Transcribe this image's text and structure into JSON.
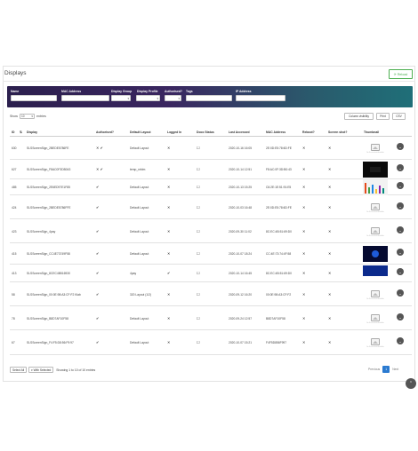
{
  "page": {
    "title": "Displays",
    "reload_label": "Reload"
  },
  "filters": {
    "name_label": "Name",
    "mac_label": "MAC Address",
    "display_group_label": "Display Group",
    "display_profile_label": "Display Profile",
    "authorised_label": "Authorised?",
    "tags_label": "Tags",
    "ip_label": "IP Address"
  },
  "table_controls": {
    "show_label": "Show",
    "page_length": "10",
    "entries_label": "entries",
    "column_visibility_label": "Column visibility",
    "print_label": "Print",
    "csv_label": "CSV"
  },
  "columns": {
    "id": "ID",
    "display": "Display",
    "authorised": "Authorised?",
    "default_layout": "Default Layout",
    "logged_in": "Logged In",
    "dooc_status": "Dooc Status",
    "last_accessed": "Last Accessed",
    "mac": "MAC Address",
    "reboot": "Reboot?",
    "screen_shot": "Screen shot?",
    "thumbnail": "Thumbnail"
  },
  "rows": [
    {
      "id": "630",
      "display": "SLSScreenSign_2BEDE5786FE",
      "authorised": "✕ ✔",
      "layout": "Default Layout",
      "logged": "✕",
      "dooc": "☐",
      "last": "2020-10-16 16:05",
      "mac": "2E:0D:E5:78:6D:FE",
      "reboot": "✕",
      "shot": "✕",
      "thumb": "placeholder"
    },
    {
      "id": "627",
      "display": "SLSScreenSign_F8AC0F3DB043",
      "authorised": "✕ ✔",
      "layout": "temp_nrbim",
      "logged": "✕",
      "dooc": "☐",
      "last": "2020-10-14 12:51",
      "mac": "F8:AC:0F:3D:B0:43",
      "reboot": "✕",
      "shot": "✕",
      "thumb": "dark"
    },
    {
      "id": "485",
      "display": "SLSScreenSign_2E6ED97E1F85",
      "authorised": "✔",
      "layout": "Default Layout",
      "logged": "✕",
      "dooc": "☐",
      "last": "2020-10-13 15:25",
      "mac": "C6:2E:1E:51:91:E5",
      "reboot": "✕",
      "shot": "✕",
      "thumb": "chart"
    },
    {
      "id": "424",
      "display": "SLSScreenSign_2BEDE5786FFE",
      "authorised": "✔",
      "layout": "Default Layout",
      "logged": "✕",
      "dooc": "☐",
      "last": "2020-10-03 16:48",
      "mac": "2E:0D:E5:78:6D:FE",
      "reboot": "✕",
      "shot": "✕",
      "thumb": "placeholder"
    },
    {
      "id": "423",
      "display": "SLSScreenSign_4pay",
      "authorised": "✔",
      "layout": "Default Layout",
      "logged": "✕",
      "dooc": "☐",
      "last": "2020-09-30 11:02",
      "mac": "8C:EC:4B:51:69:D0",
      "reboot": "✕",
      "shot": "✕",
      "thumb": "placeholder"
    },
    {
      "id": "415",
      "display": "SLSScreenSign_CC4E73749F58",
      "authorised": "✔",
      "layout": "Default Layout",
      "logged": "✕",
      "dooc": "☐",
      "last": "2020-10-07 18:24",
      "mac": "CC:4E:73:74:4F:58",
      "reboot": "✕",
      "shot": "✕",
      "thumb": "blue"
    },
    {
      "id": "413",
      "display": "SLSScreenSign_8CEC4B516930",
      "authorised": "✔",
      "layout": "4pay",
      "logged": "✔",
      "dooc": "☐",
      "last": "2020-10-14 16:45",
      "mac": "8C:EC:4B:51:69:D0",
      "reboot": "✕",
      "shot": "✕",
      "thumb": "bluebar"
    },
    {
      "id": "58",
      "display": "SLSScreenSign_00:0E:98:A3:CF:F2 Klab",
      "authorised": "✔",
      "layout": "320 Layout (1/2)",
      "logged": "✕",
      "dooc": "☐",
      "last": "2020-09-12 16:20",
      "mac": "00:0E:98:A3:CF:F2",
      "reboot": "✕",
      "shot": "✕",
      "thumb": "placeholder"
    },
    {
      "id": "78",
      "display": "SLSScreenSign_B8D7AF10F58",
      "authorised": "✔",
      "layout": "Default Layout",
      "logged": "✕",
      "dooc": "☐",
      "last": "2020-09-24 12:57",
      "mac": "B8D7AF10F58",
      "reboot": "✕",
      "shot": "✕",
      "thumb": "placeholder"
    },
    {
      "id": "67",
      "display": "SLSScreenSign_F4:F5:D8:56:F9:97",
      "authorised": "✔",
      "layout": "Default Layout",
      "logged": "✕",
      "dooc": "☐",
      "last": "2020-10-07 15:21",
      "mac": "F4F5D856F997",
      "reboot": "✕",
      "shot": "✕",
      "thumb": "placeholder"
    }
  ],
  "thumb_caption": "No Screenshot Available",
  "footer": {
    "select_all_label": "Select All",
    "with_selected_label": "With Selected",
    "info": "Showing 1 to 10 of 10 entries",
    "previous_label": "Previous",
    "current_page": "1",
    "next_label": "Next"
  },
  "icons": {
    "reload": "refresh-icon",
    "actions": "chevron-down-icon",
    "scroll_top": "chevron-up-icon"
  },
  "colors": {
    "reload": "#4caf50",
    "filter_start": "#2b1f4d",
    "filter_end": "#1f6f78",
    "page_active": "#2a7ad0"
  }
}
